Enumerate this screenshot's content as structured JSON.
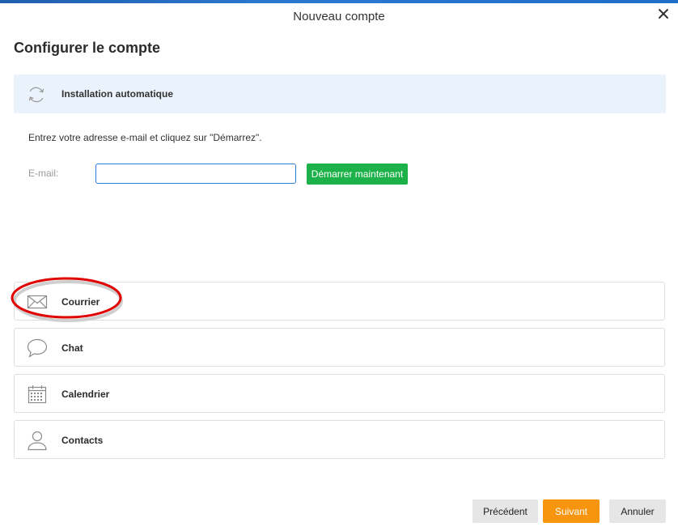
{
  "window": {
    "title": "Nouveau compte",
    "accent_color": "#2b78cf"
  },
  "header": {
    "heading": "Configurer le compte"
  },
  "auto_setup": {
    "label": "Installation automatique",
    "icon": "refresh-icon",
    "instruction": "Entrez votre adresse e-mail et cliquez sur \"Démarrez\".",
    "email_label": "E-mail:",
    "email_value": "",
    "email_placeholder": "",
    "start_button": "Démarrer maintenant",
    "start_button_color": "#1db14a"
  },
  "services": [
    {
      "label": "Courrier",
      "icon": "mail-icon"
    },
    {
      "label": "Chat",
      "icon": "chat-bubble-icon"
    },
    {
      "label": "Calendrier",
      "icon": "calendar-icon"
    },
    {
      "label": "Contacts",
      "icon": "user-icon"
    }
  ],
  "highlight_color": "#e00000",
  "footer": {
    "previous": "Précédent",
    "next": "Suivant",
    "cancel": "Annuler",
    "next_color": "#f7950f"
  }
}
